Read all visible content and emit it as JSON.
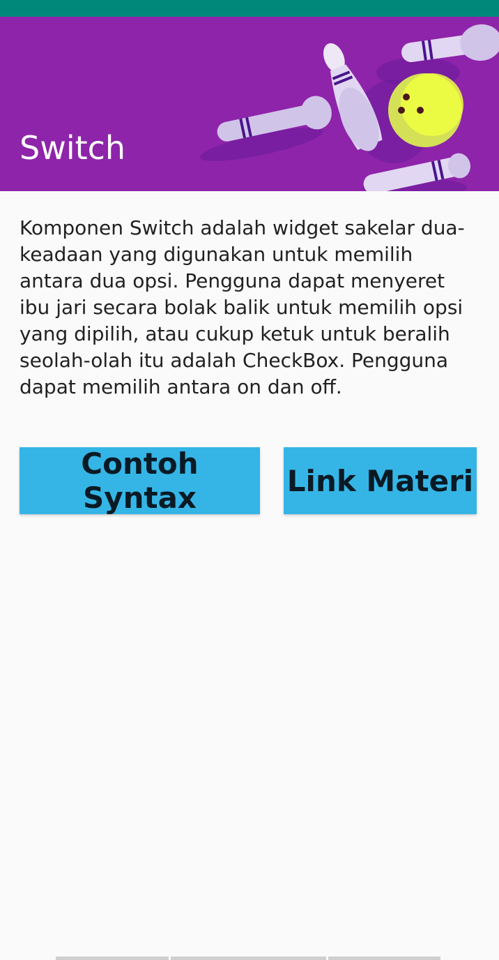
{
  "app_bar": {
    "title": "Switch",
    "color": "#8e24aa",
    "status_bar_color": "#00897b"
  },
  "content": {
    "description": "Komponen Switch adalah widget sakelar dua-keadaan yang digunakan untuk memilih antara dua opsi. Pengguna dapat menyeret ibu jari secara bolak balik untuk memilih opsi yang dipilih, atau cukup ketuk untuk beralih seolah-olah itu adalah CheckBox. Pengguna dapat memilih antara on dan off."
  },
  "buttons": {
    "syntax_label": "Contoh Syntax",
    "link_label": "Link Materi",
    "color": "#35b5e6"
  },
  "icons": {
    "hero": "bowling-pins-ball-illustration"
  }
}
